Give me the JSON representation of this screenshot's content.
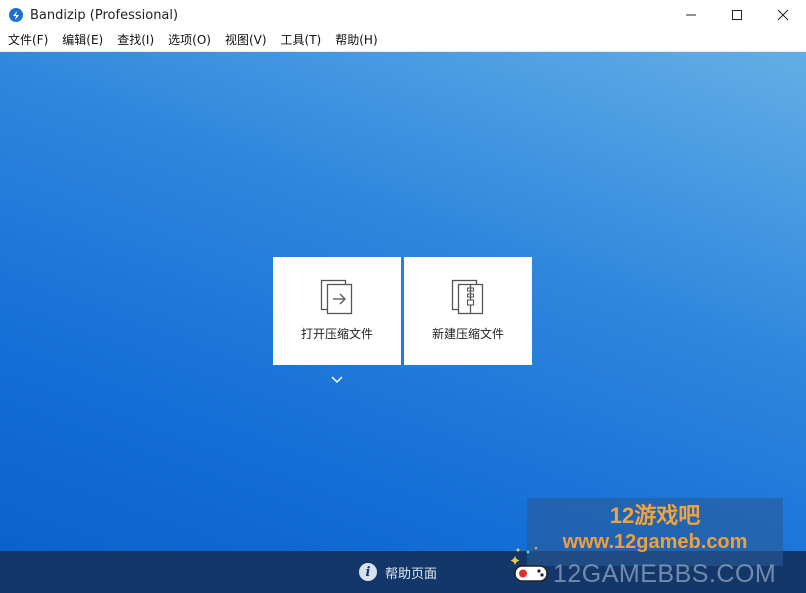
{
  "window": {
    "title": "Bandizip (Professional)",
    "icon": "bandizip-logo-icon",
    "controls": [
      "minimize-icon",
      "maximize-icon",
      "close-icon"
    ]
  },
  "menu": {
    "items": [
      {
        "label": "文件(F)"
      },
      {
        "label": "编辑(E)"
      },
      {
        "label": "查找(I)"
      },
      {
        "label": "选项(O)"
      },
      {
        "label": "视图(V)"
      },
      {
        "label": "工具(T)"
      },
      {
        "label": "帮助(H)"
      }
    ]
  },
  "main": {
    "cards": [
      {
        "label": "打开压缩文件",
        "icon": "open-archive-icon"
      },
      {
        "label": "新建压缩文件",
        "icon": "new-archive-icon"
      }
    ],
    "expand_icon": "chevron-down-icon"
  },
  "footer": {
    "help_label": "帮助页面",
    "help_icon": "info-icon",
    "help_icon_glyph": "i"
  },
  "watermark": {
    "line1": "12游戏吧",
    "line2": "www.12gameb.com",
    "line3": "12GAMEBBS.COM"
  },
  "colors": {
    "main_bg_top": "#63aee6",
    "main_bg_bottom": "#0b62cc",
    "footer_bg": "#14376a",
    "watermark_orange": "#f2a33c"
  }
}
